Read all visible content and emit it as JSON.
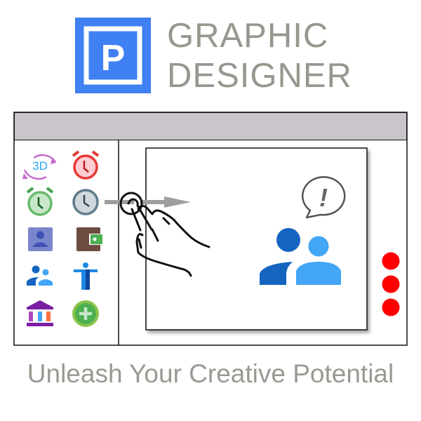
{
  "logo": {
    "letter": "P",
    "line1": "GRAPHIC",
    "line2": "DESIGNER",
    "color": "#3F80F2"
  },
  "sidebar": {
    "icons": [
      "3d-rotate-icon",
      "alarm-red-icon",
      "alarm-green-icon",
      "clock-gray-icon",
      "contact-icon",
      "wallet-icon",
      "people-icon",
      "accessibility-icon",
      "museum-icon",
      "add-circle-icon"
    ],
    "icon_3d_label": "3D"
  },
  "canvas": {
    "bubble_text": "!",
    "icons": [
      "swipe-hand-icon",
      "people-group-icon",
      "speech-bubble-alert-icon"
    ]
  },
  "indicators": {
    "count": 3,
    "color": "#FF0000"
  },
  "tagline": "Unleash Your Creative Potential"
}
